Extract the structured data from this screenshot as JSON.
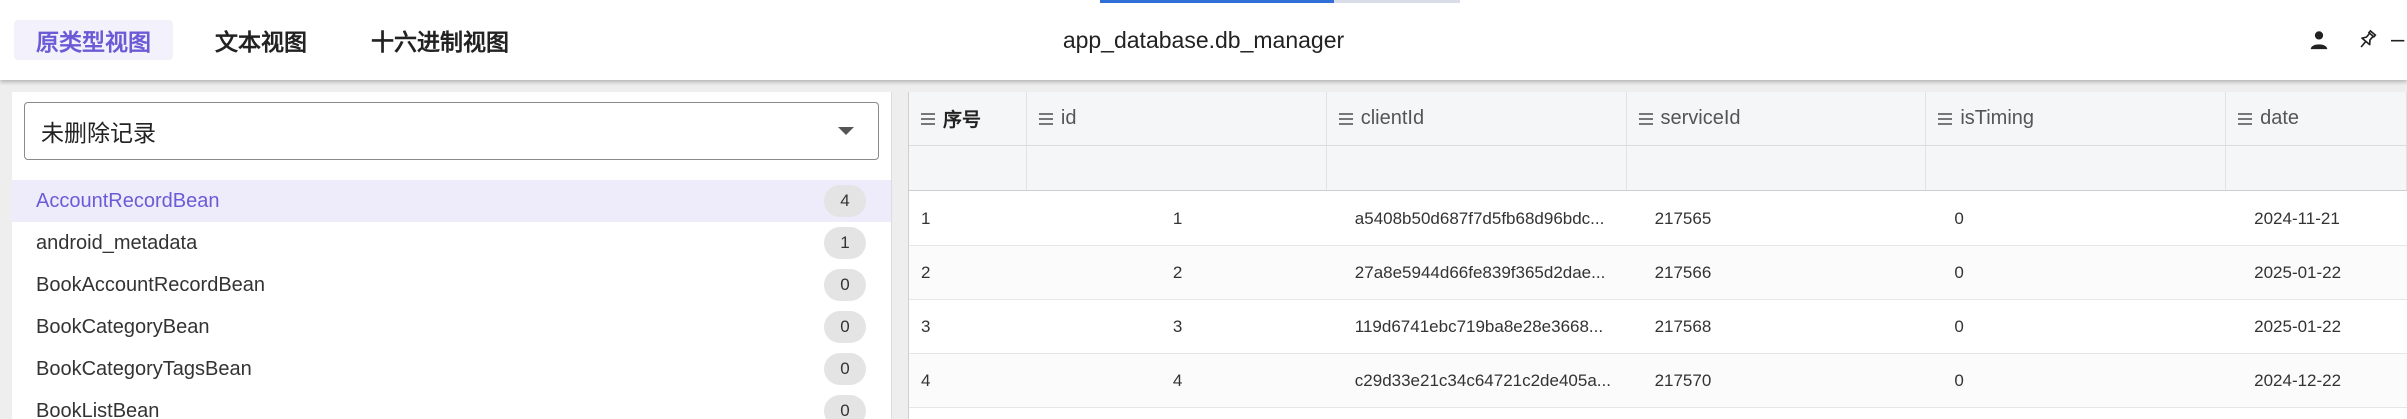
{
  "header": {
    "tabs": [
      {
        "label": "原类型视图",
        "active": true
      },
      {
        "label": "文本视图",
        "active": false
      },
      {
        "label": "十六进制视图",
        "active": false
      }
    ],
    "title": "app_database.db_manager",
    "progress_fraction": 0.65,
    "actions": [
      {
        "icon": "person-icon"
      },
      {
        "icon": "pin-icon"
      },
      {
        "icon": "overflow-icon"
      }
    ]
  },
  "left_panel": {
    "filter_select": {
      "value": "未删除记录"
    },
    "tables": [
      {
        "name": "AccountRecordBean",
        "count": "4",
        "active": true
      },
      {
        "name": "android_metadata",
        "count": "1",
        "active": false
      },
      {
        "name": "BookAccountRecordBean",
        "count": "0",
        "active": false
      },
      {
        "name": "BookCategoryBean",
        "count": "0",
        "active": false
      },
      {
        "name": "BookCategoryTagsBean",
        "count": "0",
        "active": false
      },
      {
        "name": "BookListBean",
        "count": "0",
        "active": false
      }
    ]
  },
  "grid": {
    "columns": [
      "序号",
      "id",
      "clientId",
      "serviceId",
      "isTiming",
      "date"
    ],
    "rows": [
      [
        "1",
        "1",
        "a5408b50d687f7d5fb68d96bdc...",
        "217565",
        "0",
        "2024-11-21"
      ],
      [
        "2",
        "2",
        "27a8e5944d66fe839f365d2dae...",
        "217566",
        "0",
        "2025-01-22"
      ],
      [
        "3",
        "3",
        "119d6741ebc719ba8e28e3668...",
        "217568",
        "0",
        "2025-01-22"
      ],
      [
        "4",
        "4",
        "c29d33e21c34c64721c2de405a...",
        "217570",
        "0",
        "2024-12-22"
      ]
    ]
  },
  "colors": {
    "accent": "#6b5bd6",
    "accent_bg": "#eeebfb",
    "progress": "#2f6fd6"
  }
}
